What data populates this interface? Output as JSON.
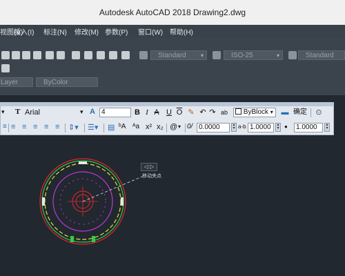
{
  "window": {
    "title": "Autodesk AutoCAD 2018    Drawing2.dwg"
  },
  "menu": [
    {
      "label": "视图(V)"
    },
    {
      "label": "插入(I)"
    },
    {
      "label": "标注(N)"
    },
    {
      "label": "修改(M)"
    },
    {
      "label": "参数(P)"
    },
    {
      "label": "窗口(W)"
    },
    {
      "label": "帮助(H)"
    }
  ],
  "styles": {
    "text_style": "Standard",
    "dim_style": "ISO-25",
    "table_style": "Standard"
  },
  "layers": {
    "layer": "Layer",
    "color": "ByColor"
  },
  "text_format": {
    "style_glyph": "T",
    "font": "Arial",
    "height_glyph": "A",
    "height": "4",
    "bold": "B",
    "italic": "I",
    "strike": "A",
    "underline": "U",
    "overline": "O",
    "color": "ByBlock",
    "ok_label": "确定",
    "superscript": "x²",
    "subscript": "x₂",
    "symbol": "@",
    "oblique_icon_label": "0/",
    "oblique": "0.0000",
    "tracking_icon_label": "a-b",
    "tracking": "1.0000",
    "width_icon_label": "●",
    "width_factor": "1.0000"
  },
  "canvas": {
    "tooltip_arrows": "◁ ▷",
    "tooltip_text": "移动夹点"
  },
  "colors": {
    "canvas_bg": "#212830",
    "circle_red": "#e8252c",
    "circle_green": "#37c84a",
    "circle_yellow": "#e9e13a",
    "circle_magenta": "#c236d6",
    "circle_white": "#e7e7e7"
  }
}
